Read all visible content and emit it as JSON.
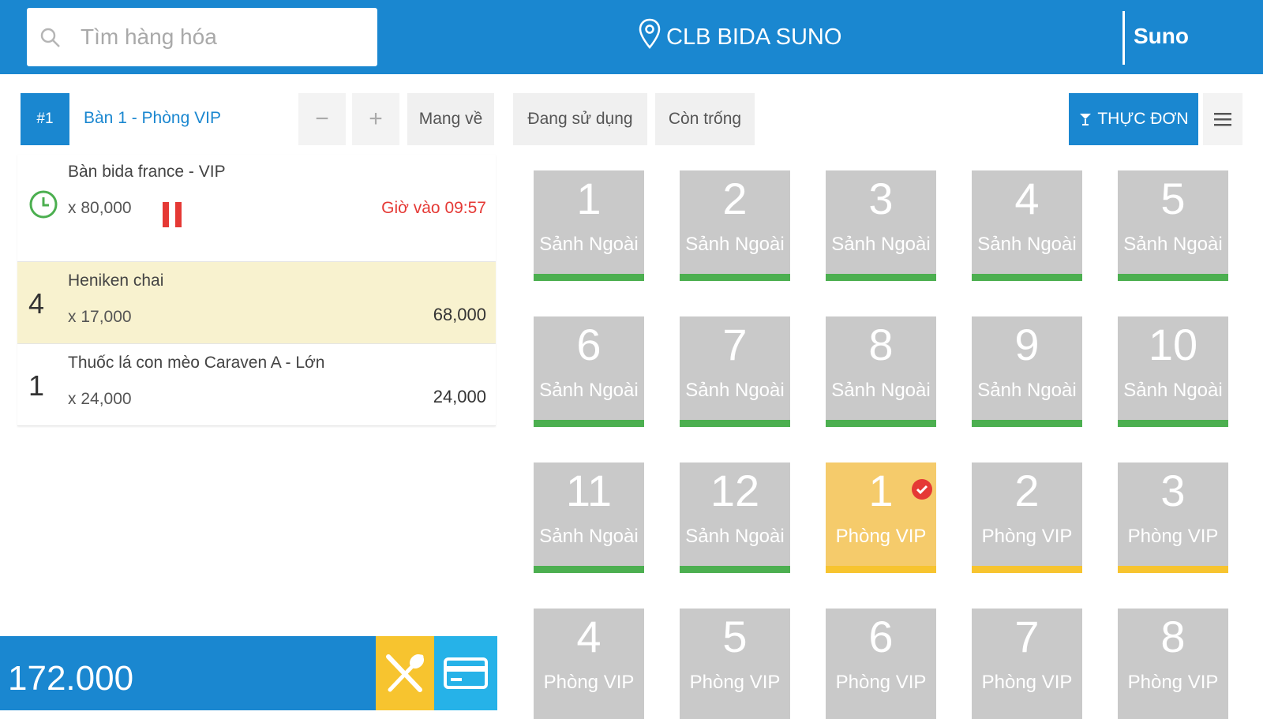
{
  "header": {
    "search_placeholder": "Tìm hàng hóa",
    "store_name": "CLB BIDA SUNO",
    "user_name": "Suno"
  },
  "toolbar": {
    "order_badge": "#1",
    "order_title": "Bàn 1 - Phòng VIP",
    "minus_label": "−",
    "plus_label": "+",
    "takeaway_label": "Mang về",
    "filter_in_use": "Đang sử dụng",
    "filter_empty": "Còn trống",
    "menu_label": "THỰC ĐƠN"
  },
  "order": {
    "timed_item": {
      "name": "Bàn bida france - VIP",
      "price": "x 80,000",
      "time_in": "Giờ vào 09:57"
    },
    "items": [
      {
        "qty": "4",
        "name": "Heniken chai",
        "price": "x 17,000",
        "total": "68,000",
        "highlighted": true
      },
      {
        "qty": "1",
        "name": "Thuốc lá con mèo Caraven A - Lớn",
        "price": "x 24,000",
        "total": "24,000",
        "highlighted": false
      }
    ],
    "grand_total": "172.000"
  },
  "colors": {
    "brand_blue": "#1a87d0",
    "status_free": "#4caf50",
    "status_vip": "#f7c42f",
    "active_table": "#f5cb6b",
    "alert_red": "#e53935"
  },
  "tables": [
    {
      "number": "1",
      "zone": "Sảnh Ngoài",
      "status": "free"
    },
    {
      "number": "2",
      "zone": "Sảnh Ngoài",
      "status": "free"
    },
    {
      "number": "3",
      "zone": "Sảnh Ngoài",
      "status": "free"
    },
    {
      "number": "4",
      "zone": "Sảnh Ngoài",
      "status": "free"
    },
    {
      "number": "5",
      "zone": "Sảnh Ngoài",
      "status": "free"
    },
    {
      "number": "6",
      "zone": "Sảnh Ngoài",
      "status": "free"
    },
    {
      "number": "7",
      "zone": "Sảnh Ngoài",
      "status": "free"
    },
    {
      "number": "8",
      "zone": "Sảnh Ngoài",
      "status": "free"
    },
    {
      "number": "9",
      "zone": "Sảnh Ngoài",
      "status": "free"
    },
    {
      "number": "10",
      "zone": "Sảnh Ngoài",
      "status": "free"
    },
    {
      "number": "11",
      "zone": "Sảnh Ngoài",
      "status": "free"
    },
    {
      "number": "12",
      "zone": "Sảnh Ngoài",
      "status": "free"
    },
    {
      "number": "1",
      "zone": "Phòng VIP",
      "status": "selected"
    },
    {
      "number": "2",
      "zone": "Phòng VIP",
      "status": "vip"
    },
    {
      "number": "3",
      "zone": "Phòng VIP",
      "status": "vip"
    },
    {
      "number": "4",
      "zone": "Phòng VIP",
      "status": "none"
    },
    {
      "number": "5",
      "zone": "Phòng VIP",
      "status": "none"
    },
    {
      "number": "6",
      "zone": "Phòng VIP",
      "status": "none"
    },
    {
      "number": "7",
      "zone": "Phòng VIP",
      "status": "none"
    },
    {
      "number": "8",
      "zone": "Phòng VIP",
      "status": "none"
    }
  ]
}
